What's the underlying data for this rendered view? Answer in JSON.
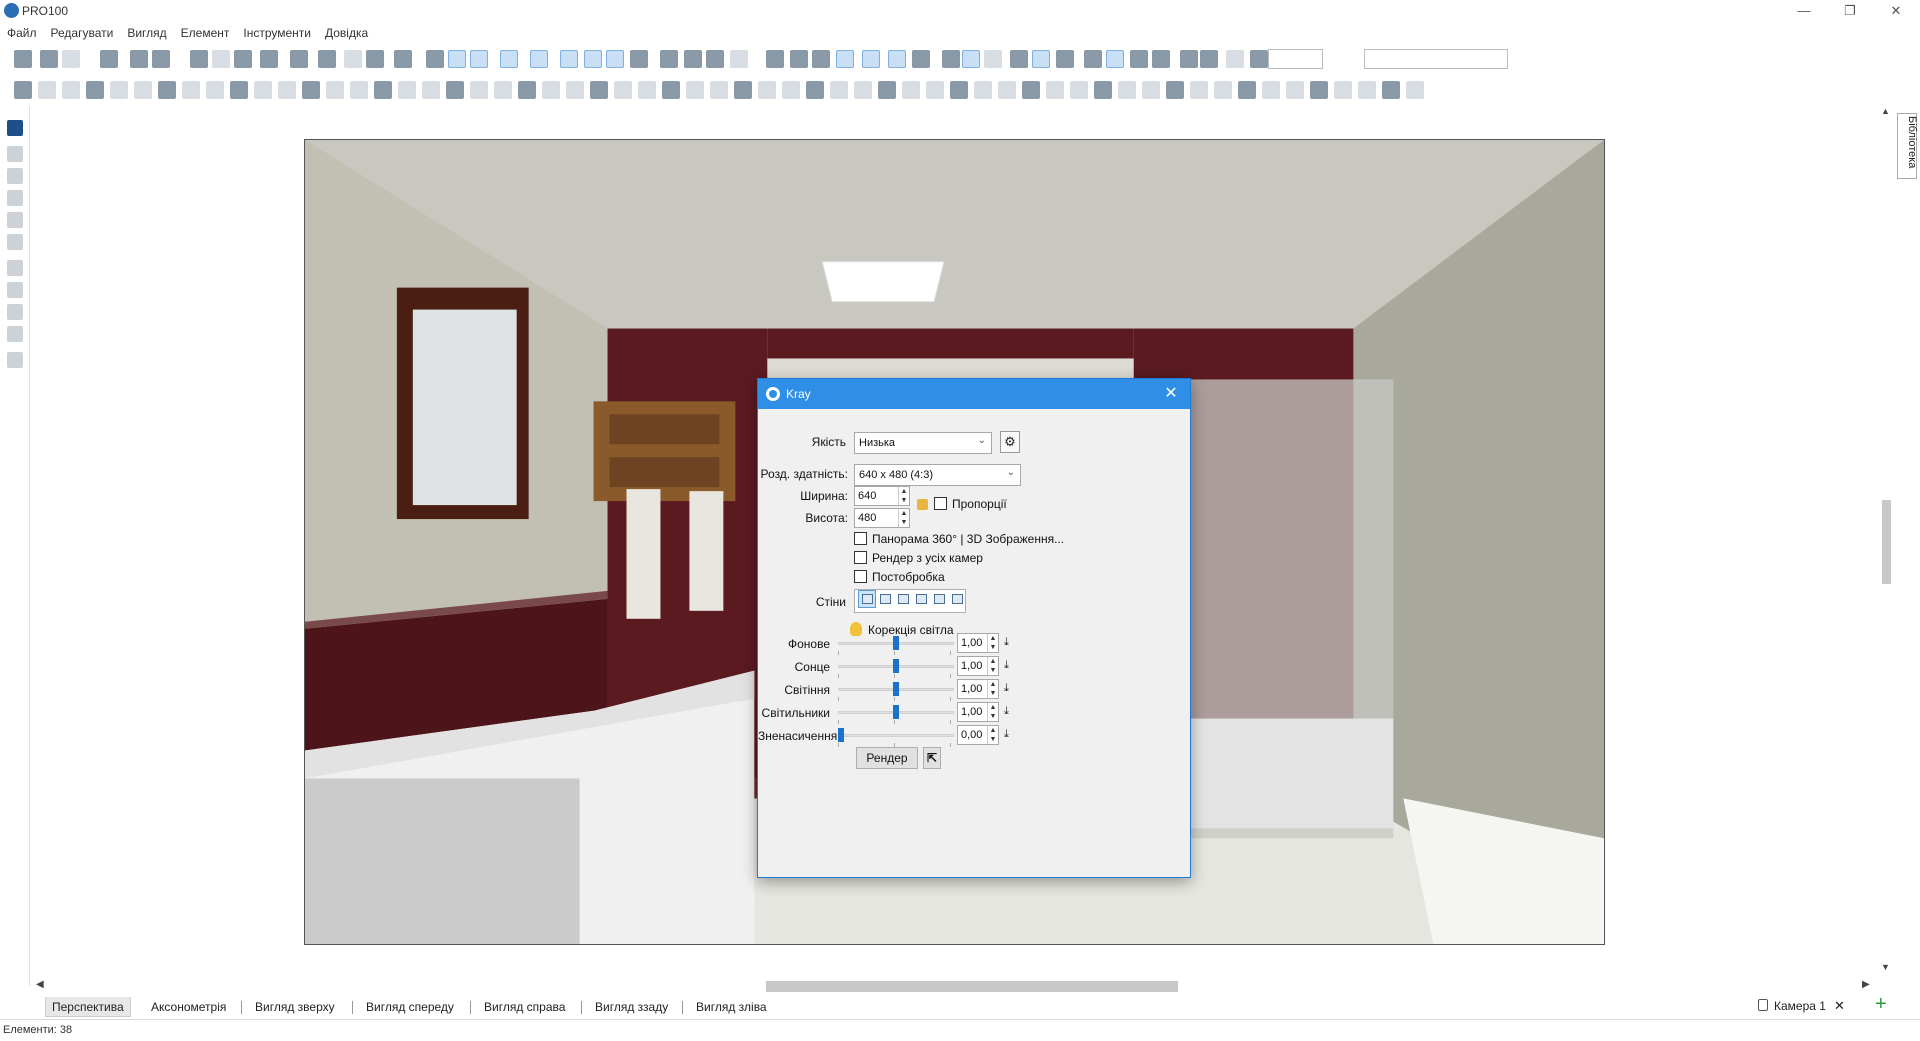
{
  "window": {
    "title": "PRO100",
    "min": "—",
    "max": "❐",
    "close": "✕"
  },
  "menu": [
    "Файл",
    "Редагувати",
    "Вигляд",
    "Елемент",
    "Інструменти",
    "Довідка"
  ],
  "toolbar": {
    "zoom_value": "",
    "view_select": ""
  },
  "library_tab": "Бібліотека",
  "view_tabs": [
    "Перспектива",
    "Аксонометрія",
    "Вигляд зверху",
    "Вигляд спереду",
    "Вигляд справа",
    "Вигляд ззаду",
    "Вигляд зліва"
  ],
  "active_view_tab": 0,
  "camera_tab": {
    "label": "Камера 1",
    "close": "✕",
    "add": "+"
  },
  "status": {
    "elements": "Елементи: 38"
  },
  "dialog": {
    "title": "Kray",
    "close": "✕",
    "quality_label": "Якість",
    "quality_value": "Низька",
    "resolution_label": "Розд. здатність:",
    "resolution_value": "640 x 480 (4:3)",
    "width_label": "Ширина:",
    "width_value": "640",
    "height_label": "Висота:",
    "height_value": "480",
    "proportions_label": "Пропорції",
    "panorama_label": "Панорама 360° | 3D Зображення...",
    "render_all_label": "Рендер з усіх камер",
    "postprocess_label": "Постобробка",
    "walls_label": "Стіни",
    "light_correction_label": "Корекція світла",
    "sliders": [
      {
        "label": "Фонове",
        "value": "1,00",
        "level": 0.5
      },
      {
        "label": "Сонце",
        "value": "1,00",
        "level": 0.5
      },
      {
        "label": "Світіння",
        "value": "1,00",
        "level": 0.5
      },
      {
        "label": "Світильники",
        "value": "1,00",
        "level": 0.5
      },
      {
        "label": "Зненасичення",
        "value": "0,00",
        "level": 0.0
      }
    ],
    "render_button": "Рендер"
  }
}
